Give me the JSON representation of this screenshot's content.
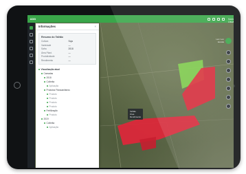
{
  "app": {
    "logo_text": "ADD",
    "user_label": "Nome Usuário",
    "accent": "#3aa64a"
  },
  "panel": {
    "title": "Informações",
    "close": "×",
    "section_title": "Resumo do Talhão",
    "fields": [
      {
        "k": "Cultura",
        "v": "Soja"
      },
      {
        "k": "Variedade",
        "v": "—"
      },
      {
        "k": "Safra",
        "v": "2018"
      },
      {
        "k": "Área Plant.",
        "v": "—"
      },
      {
        "k": "Produtividade",
        "v": "—"
      },
      {
        "k": "Rendimento",
        "v": "—"
      }
    ],
    "tree": [
      {
        "level": "n1",
        "text": "Visualização atual"
      },
      {
        "level": "n2",
        "text": "Camadas"
      },
      {
        "level": "n3",
        "text": "2018"
      },
      {
        "level": "n3",
        "text": "Colheita"
      },
      {
        "level": "n4",
        "text": "Aplicação"
      },
      {
        "level": "n3",
        "text": "Produtos Fitossanitários"
      },
      {
        "level": "n4",
        "text": "Produto"
      },
      {
        "level": "n4",
        "text": "Produto"
      },
      {
        "level": "n4",
        "text": "Produto"
      },
      {
        "level": "n4",
        "text": "Produto"
      },
      {
        "level": "n3",
        "text": "Fertilização"
      },
      {
        "level": "n4",
        "text": "Produto"
      },
      {
        "level": "n2",
        "text": "2019"
      },
      {
        "level": "n3",
        "text": "Colheita"
      },
      {
        "level": "n4",
        "text": "Aplicação"
      }
    ]
  },
  "map": {
    "coords_line1": "Lat / Lon",
    "coords_line2": "Escala",
    "tooltip_line1": "Talhão",
    "tooltip_line2": "Área",
    "tooltip_line3": "Rendimento",
    "field_green": "#7fd14b",
    "field_red": "#e0263a"
  }
}
